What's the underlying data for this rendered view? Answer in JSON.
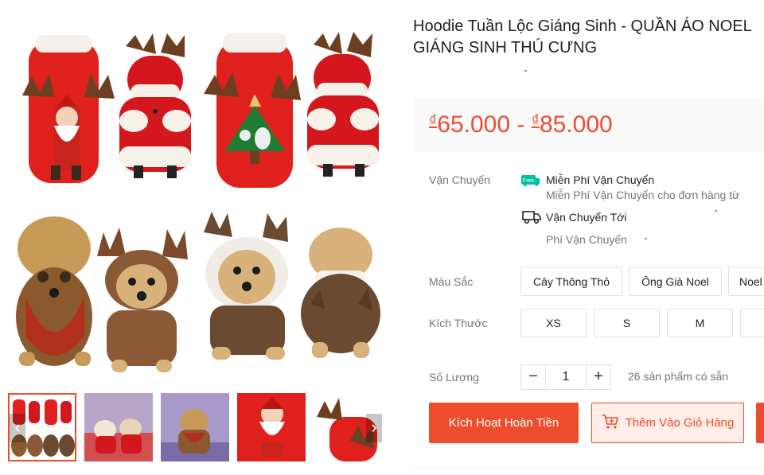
{
  "product": {
    "title_line1": "Hoodie Tuần Lộc Giáng Sinh - QUẦN ÁO NOEL",
    "title_line2": "GIÁNG SINH THÚ CƯNG",
    "currency_symbol": "₫",
    "price_min": "65.000",
    "price_separator": " - ",
    "price_max": "85.000"
  },
  "shipping": {
    "label": "Vận Chuyển",
    "free_badge": "Free",
    "free_title": "Miễn Phí Vận Chuyển",
    "free_desc": "Miễn Phí Vận Chuyển cho đơn hàng từ",
    "to_label": "Vận Chuyển Tới",
    "fee_label": "Phí Vận Chuyển"
  },
  "color": {
    "label": "Màu Sắc",
    "options": [
      "Cây Thông Thỏ",
      "Ông Già Noel",
      "Noel"
    ]
  },
  "size": {
    "label": "Kích Thước",
    "options": [
      "XS",
      "S",
      "M",
      ""
    ]
  },
  "quantity": {
    "label": "Số Lượng",
    "minus": "−",
    "value": "1",
    "plus": "+",
    "stock_text": "26 sản phẩm có sẵn"
  },
  "actions": {
    "buy_label": "Kích Hoạt Hoàn Tiền",
    "cart_label": "Thêm Vào Giỏ Hàng"
  },
  "gallery": {
    "prev": "‹",
    "next": "›",
    "active_index": 0,
    "thumbnail_count": 5
  },
  "colors": {
    "accent": "#ee4d2d",
    "accent_light": "#ffeee8",
    "free_badge": "#00bfa5",
    "price_bg": "#fafafa"
  }
}
